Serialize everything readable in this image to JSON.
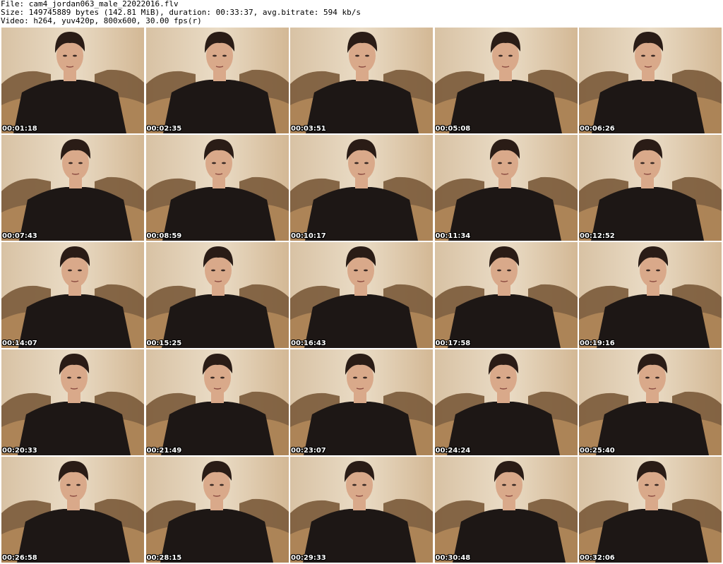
{
  "header": {
    "file_line": "File: cam4_jordan063_male_22022016.flv",
    "size_line": "Size: 149745889 bytes (142.81 MiB), duration: 00:33:37, avg.bitrate: 594 kb/s",
    "video_line": "Video: h264, yuv420p, 800x600, 30.00 fps(r)"
  },
  "colors": {
    "wall": "#eadcc6",
    "cushion": "#7a5a3a",
    "shirt": "#1d1715",
    "skin": "#d9a98a",
    "hair": "#2a1c16"
  },
  "thumbnails": [
    {
      "timestamp": "00:01:18"
    },
    {
      "timestamp": "00:02:35"
    },
    {
      "timestamp": "00:03:51"
    },
    {
      "timestamp": "00:05:08"
    },
    {
      "timestamp": "00:06:26"
    },
    {
      "timestamp": "00:07:43"
    },
    {
      "timestamp": "00:08:59"
    },
    {
      "timestamp": "00:10:17"
    },
    {
      "timestamp": "00:11:34"
    },
    {
      "timestamp": "00:12:52"
    },
    {
      "timestamp": "00:14:07"
    },
    {
      "timestamp": "00:15:25"
    },
    {
      "timestamp": "00:16:43"
    },
    {
      "timestamp": "00:17:58"
    },
    {
      "timestamp": "00:19:16"
    },
    {
      "timestamp": "00:20:33"
    },
    {
      "timestamp": "00:21:49"
    },
    {
      "timestamp": "00:23:07"
    },
    {
      "timestamp": "00:24:24"
    },
    {
      "timestamp": "00:25:40"
    },
    {
      "timestamp": "00:26:58"
    },
    {
      "timestamp": "00:28:15"
    },
    {
      "timestamp": "00:29:33"
    },
    {
      "timestamp": "00:30:48"
    },
    {
      "timestamp": "00:32:06"
    }
  ]
}
